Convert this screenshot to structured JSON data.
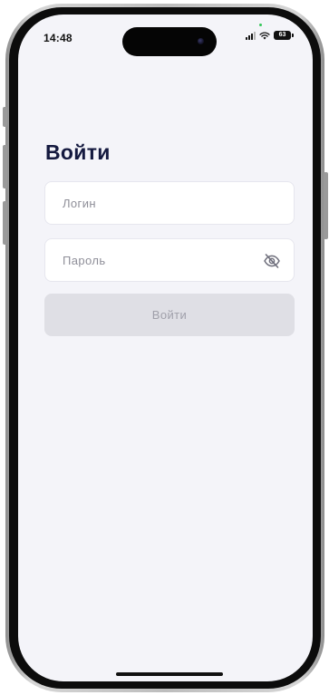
{
  "status_bar": {
    "time": "14:48",
    "battery_level": "63",
    "icons": [
      "signal-icon",
      "wifi-icon",
      "battery-icon"
    ]
  },
  "login_form": {
    "title": "Войти",
    "login_placeholder": "Логин",
    "login_value": "",
    "password_placeholder": "Пароль",
    "password_value": "",
    "password_toggle_icon": "eye-off-icon",
    "submit_label": "Войти",
    "submit_enabled": false
  },
  "colors": {
    "background": "#f4f4f9",
    "title": "#14193f",
    "field_background": "#ffffff",
    "field_border": "#e6e6ee",
    "placeholder": "#8e8e98",
    "button_disabled_background": "#dfdfe5",
    "button_disabled_text": "#a0a0aa"
  }
}
